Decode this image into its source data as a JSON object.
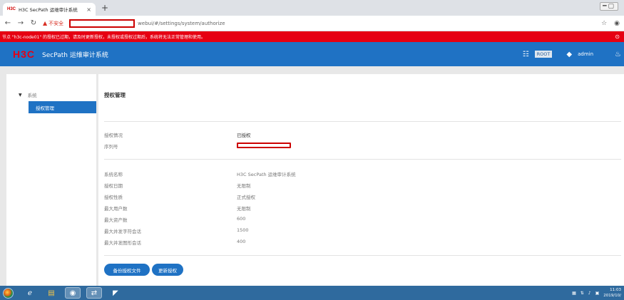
{
  "browser": {
    "tab_favicon": "H3C",
    "tab_title": "H3C SecPath 运维审计系统",
    "tab_close": "×",
    "new_tab": "+",
    "security_label": "不安全",
    "url": "webui/#/settings/system/authorize"
  },
  "banner": {
    "text": "节点 \"h3c-node01\" 的授权已过期，请及时更新授权，未授权或授权过期后，系统将无法正常管理和使用。"
  },
  "header": {
    "logo": "H3C",
    "title": "SecPath 运维审计系统",
    "user_role": "ROOT",
    "username": "admin"
  },
  "sidebar": {
    "root_label": "系统",
    "items": [
      {
        "label": "授权管理",
        "active": true
      }
    ]
  },
  "main": {
    "title": "授权管理",
    "status": {
      "label": "授权情况",
      "value": "已授权",
      "serial_label": "序列号"
    },
    "details": [
      {
        "label": "系统名称",
        "value": "H3C SecPath 运维审计系统"
      },
      {
        "label": "授权日期",
        "value": "无限制"
      },
      {
        "label": "授权性质",
        "value": "正式授权"
      },
      {
        "label": "最大用户数",
        "value": "无限制"
      },
      {
        "label": "最大资产数",
        "value": "600"
      },
      {
        "label": "最大并发字符会话",
        "value": "1500"
      },
      {
        "label": "最大并发图形会话",
        "value": "400"
      }
    ],
    "buttons": {
      "backup": "备份授权文件",
      "update": "更新授权"
    }
  },
  "taskbar": {
    "time": "11:03",
    "date": "2019/10/"
  },
  "colors": {
    "primary": "#1f72c4",
    "banner": "#e60012",
    "logo": "#e60012"
  }
}
